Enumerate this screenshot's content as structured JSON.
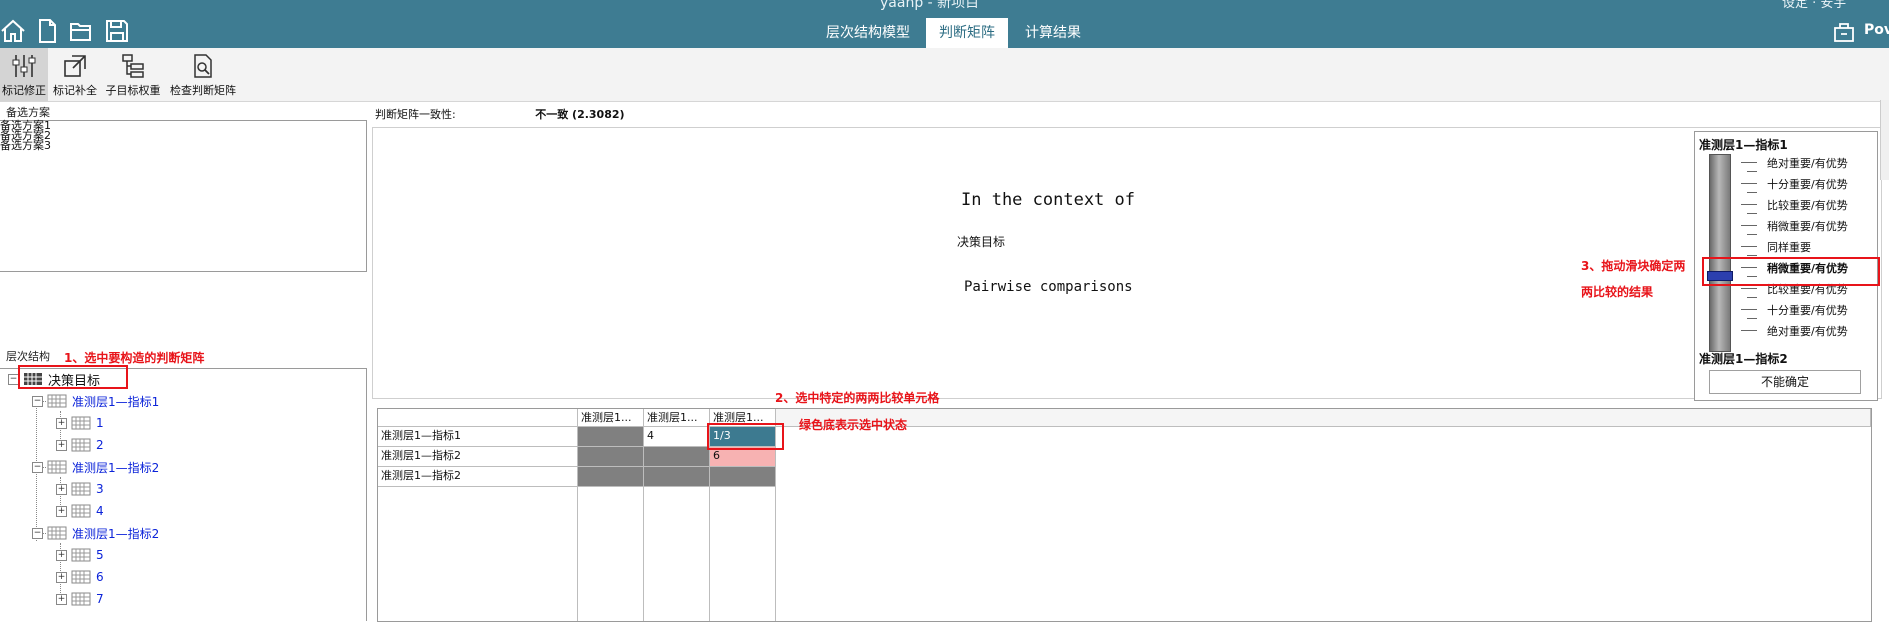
{
  "window": {
    "title": "yaahp - 新项目",
    "user": "设定 · 安宇"
  },
  "quick_access": [
    "home-icon",
    "new-file-icon",
    "open-folder-icon",
    "save-icon"
  ],
  "tabs": [
    {
      "label": "层次结构模型",
      "active": false
    },
    {
      "label": "判断矩阵",
      "active": true
    },
    {
      "label": "计算结果",
      "active": false
    }
  ],
  "power_label": "Pov",
  "ribbon": {
    "buttons": [
      {
        "label": "标记修正",
        "icon": "sliders-icon",
        "active": true
      },
      {
        "label": "标记补全",
        "icon": "external-link-icon",
        "active": false
      },
      {
        "label": "子目标权重",
        "icon": "hierarchy-icon",
        "active": false
      },
      {
        "label": "检查判断矩阵",
        "icon": "document-search-icon",
        "active": false
      }
    ]
  },
  "alternatives": {
    "label": "备选方案",
    "items": [
      "备选方案1",
      "备选方案2",
      "备选方案3"
    ]
  },
  "hierarchy": {
    "label": "层次结构",
    "root": "决策目标",
    "nodes": [
      {
        "label": "准测层1—指标1",
        "children": [
          "1",
          "2"
        ]
      },
      {
        "label": "准测层1—指标2",
        "children": [
          "3",
          "4"
        ]
      },
      {
        "label": "准测层1—指标2",
        "children": [
          "5",
          "6",
          "7"
        ]
      }
    ]
  },
  "consistency": {
    "label": "判断矩阵一致性:",
    "value": "不一致 (2.3082)"
  },
  "canvas": {
    "context_heading": "In the context of",
    "context_target": "决策目标",
    "pairwise_label": "Pairwise comparisons"
  },
  "slider": {
    "top_label": "准测层1—指标1",
    "bottom_label": "准测层1—指标2",
    "scale": [
      "绝对重要/有优势",
      "十分重要/有优势",
      "比较重要/有优势",
      "稍微重要/有优势",
      "同样重要",
      "稍微重要/有优势",
      "比较重要/有优势",
      "十分重要/有优势",
      "绝对重要/有优势"
    ],
    "selected_index": 5,
    "cannot_decide": "不能确定"
  },
  "matrix": {
    "col_headers": [
      "准测层1...",
      "准测层1...",
      "准测层1..."
    ],
    "rows": [
      {
        "label": "准测层1—指标1",
        "cells": [
          "",
          "4",
          "1/3"
        ]
      },
      {
        "label": "准测层1—指标2",
        "cells": [
          "",
          "",
          "6"
        ]
      },
      {
        "label": "准测层1—指标2",
        "cells": [
          "",
          "",
          ""
        ]
      }
    ]
  },
  "annotations": {
    "step1": "1、选中要构造的判断矩阵",
    "step2": "2、选中特定的两两比较单元格",
    "step2_note": "绿色底表示选中状态",
    "step3_line1": "3、拖动滑块确定两",
    "step3_line2": "两比较的结果"
  },
  "colors": {
    "title_bar": "#3e7c92",
    "selected_cell": "#3d7a90",
    "annotation": "#e8141a",
    "tree_link": "#0b23d9"
  }
}
